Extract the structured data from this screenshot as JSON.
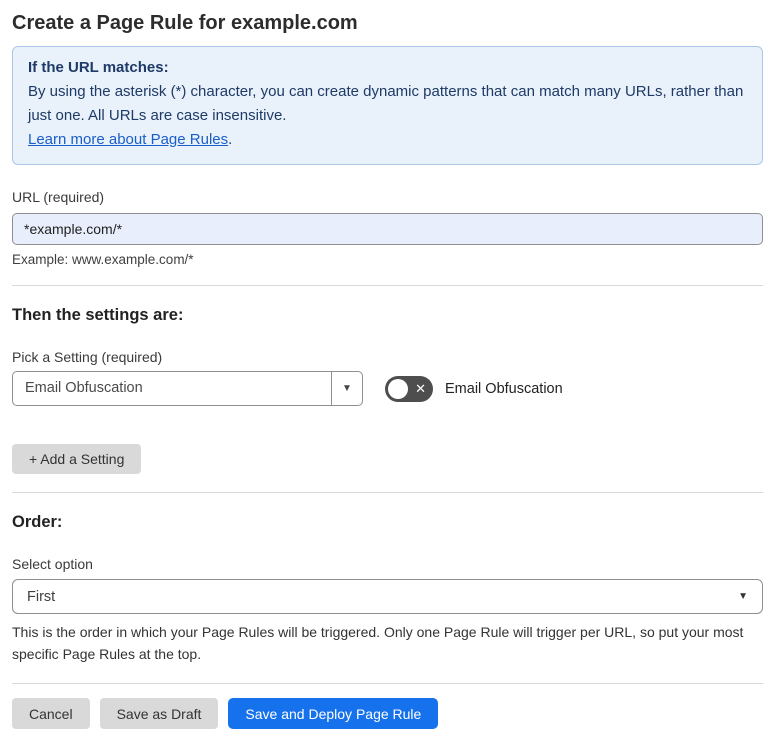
{
  "page": {
    "title": "Create a Page Rule for example.com"
  },
  "info_box": {
    "heading": "If the URL matches:",
    "body": "By using the asterisk (*) character, you can create dynamic patterns that can match many URLs, rather than just one. All URLs are case insensitive.",
    "link": "Learn more about Page Rules",
    "link_suffix": "."
  },
  "url_section": {
    "label": "URL (required)",
    "value": "*example.com/*",
    "helper": "Example: www.example.com/*"
  },
  "settings_section": {
    "heading": "Then the settings are:",
    "pick_label": "Pick a Setting (required)",
    "selected_setting": "Email Obfuscation",
    "toggle_label": "Email Obfuscation",
    "toggle_state": "off",
    "add_button": "+ Add a Setting"
  },
  "order_section": {
    "heading": "Order:",
    "label": "Select option",
    "selected": "First",
    "helper": "This is the order in which your Page Rules will be triggered. Only one Page Rule will trigger per URL, so put your most specific Page Rules at the top."
  },
  "footer": {
    "cancel": "Cancel",
    "save_draft": "Save as Draft",
    "save_deploy": "Save and Deploy Page Rule"
  },
  "icons": {
    "dropdown_arrow": "▼",
    "toggle_off_x": "✕"
  },
  "colors": {
    "accent_blue": "#1672ec",
    "info_bg": "#e9f1fb",
    "info_border": "#abc8e8",
    "info_text": "#1e3a66",
    "link_blue": "#1a5fc8",
    "input_bg": "#e8eefb",
    "button_gray": "#d9d9d9",
    "toggle_gray": "#4e4e4e"
  }
}
